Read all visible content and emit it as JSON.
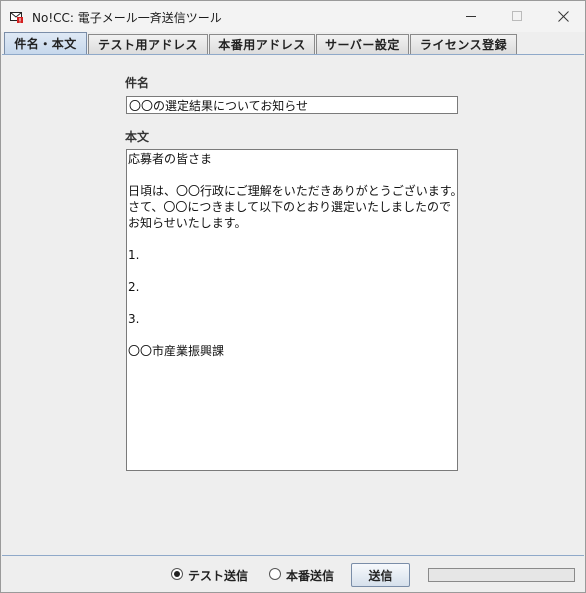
{
  "window": {
    "title": "No!CC: 電子メール一斉送信ツール",
    "minimize_icon": "minimize-icon",
    "maximize_icon": "maximize-icon",
    "close_icon": "close-icon"
  },
  "tabs": [
    {
      "label": "件名・本文",
      "active": true
    },
    {
      "label": "テスト用アドレス",
      "active": false
    },
    {
      "label": "本番用アドレス",
      "active": false
    },
    {
      "label": "サーバー設定",
      "active": false
    },
    {
      "label": "ライセンス登録",
      "active": false
    }
  ],
  "form": {
    "subject_label": "件名",
    "subject_value": "〇〇の選定結果についてお知らせ",
    "body_label": "本文",
    "body_value": "応募者の皆さま\n\n日頃は、〇〇行政にご理解をいただきありがとうございます。\nさて、〇〇につきまして以下のとおり選定いたしましたので\nお知らせいたします。\n\n1.\n\n2.\n\n3.\n\n〇〇市産業振興課\n\n\n"
  },
  "footer": {
    "radio_test_label": "テスト送信",
    "radio_test_checked": true,
    "radio_prod_label": "本番送信",
    "radio_prod_checked": false,
    "send_label": "送信",
    "progress": 0
  },
  "colors": {
    "active_tab": "#c7d8ec",
    "accent_border": "#8fa9c9"
  }
}
